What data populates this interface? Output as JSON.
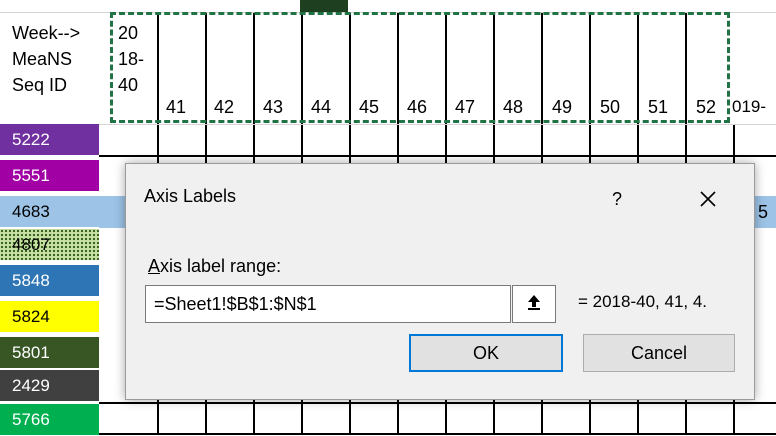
{
  "sheet": {
    "header_labels": [
      "Week-->",
      "MeaNS",
      "Seq ID"
    ],
    "first_col_header": [
      "20",
      "18-",
      "40"
    ],
    "week_numbers": [
      "41",
      "42",
      "43",
      "44",
      "45",
      "46",
      "47",
      "48",
      "49",
      "50",
      "51",
      "52"
    ],
    "overflow_text": "019-",
    "row_values": [
      {
        "id": "5222",
        "color": "#7030a0",
        "text_color": "#ffffff"
      },
      {
        "id": "5551",
        "color": "#a100a5",
        "text_color": "#ffffff"
      },
      {
        "id": "4683",
        "color": "#9dc3e6",
        "text_color": "#000000"
      },
      {
        "id": "4807",
        "color": "#c7dfa3",
        "text_color": "#000000",
        "pattern": "dotted"
      },
      {
        "id": "5848",
        "color": "#2e75b6",
        "text_color": "#ffffff"
      },
      {
        "id": "5824",
        "color": "#ffff00",
        "text_color": "#000000"
      },
      {
        "id": "5801",
        "color": "#375623",
        "text_color": "#ffffff"
      },
      {
        "id": "2429",
        "color": "#404040",
        "text_color": "#ffffff"
      },
      {
        "id": "5766",
        "color": "#00b050",
        "text_color": "#ffffff"
      }
    ],
    "partial_cell_text": "5"
  },
  "dialog": {
    "title": "Axis Labels",
    "help_label": "?",
    "close_icon": "close-icon",
    "field_label_underlined": "A",
    "field_label_rest": "xis label range:",
    "range_value": "=Sheet1!$B$1:$N$1",
    "collapse_icon": "upload-arrow-icon",
    "preview_text": "= 2018-40, 41, 4.",
    "ok_label": "OK",
    "cancel_label": "Cancel"
  }
}
